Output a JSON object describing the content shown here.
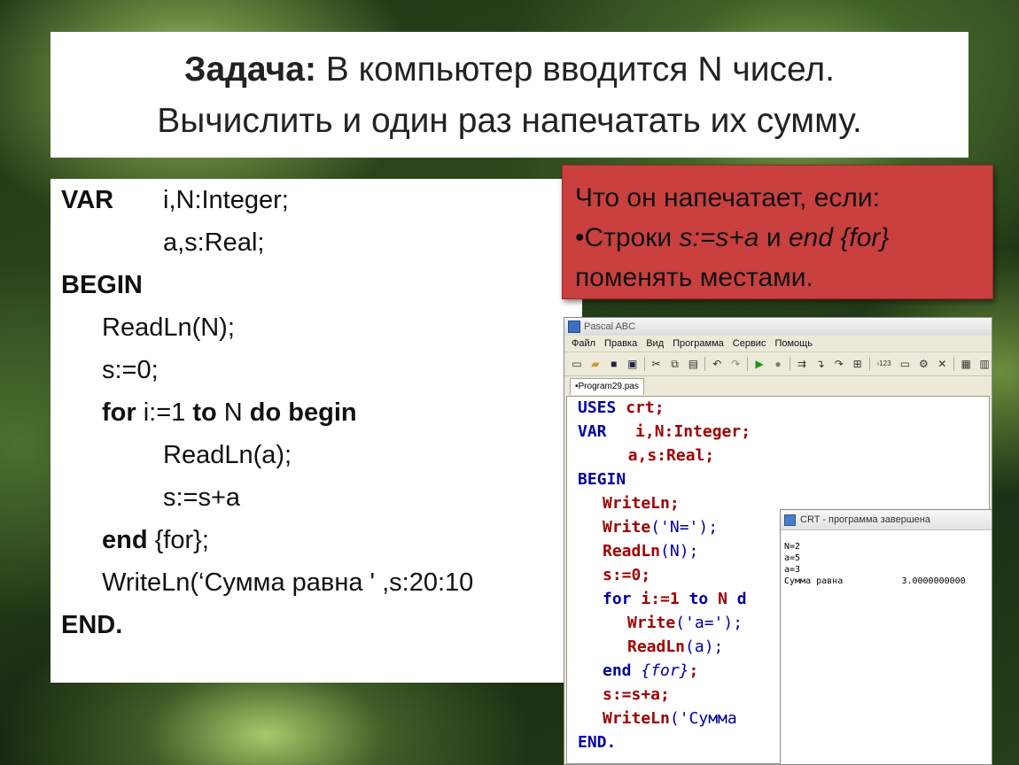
{
  "task": {
    "label": "Задача:",
    "line1": "В компьютер вводится N чисел.",
    "line2": "Вычислить и один раз напечатать их сумму."
  },
  "code": {
    "l1_kw": "VAR",
    "l1_rest": "i,N:Integer;",
    "l2": "a,s:Real;",
    "l3": "BEGIN",
    "l4": "ReadLn(N);",
    "l5": "s:=0;",
    "l6_kw1": "for",
    "l6_a": " i:=1 ",
    "l6_kw2": "to",
    "l6_b": " N ",
    "l6_kw3": "do begin",
    "l7": "ReadLn(a);",
    "l8": "s:=s+a",
    "l9_kw": "end",
    "l9_rest": " {for};",
    "l10": "WriteLn(‘Сумма равна ' ,s:20:10",
    "l11": "END."
  },
  "question": {
    "line1": "Что он напечатает, если:",
    "bullet_prefix": "•Строки ",
    "stmt1": "s:=s+a",
    "and": " и ",
    "stmt2": "end {for}",
    "line3": "поменять местами."
  },
  "pascal_window": {
    "title": "Pascal ABC",
    "menu": [
      "Файл",
      "Правка",
      "Вид",
      "Программа",
      "Сервис",
      "Помощь"
    ],
    "tab": "•Program29.pas",
    "toolbar_icons": [
      "new-file-icon",
      "open-icon",
      "save-icon",
      "save-all-icon",
      "cut-icon",
      "copy-icon",
      "paste-icon",
      "undo-icon",
      "redo-icon",
      "run-icon",
      "stop-icon",
      "step-icon",
      "step-into-icon",
      "step-over-icon",
      "watch-icon",
      "format-icon",
      "window-icon",
      "options-icon",
      "close-icon",
      "print-icon",
      "help-icon"
    ],
    "toolbar_glyphs": {
      "new": "🗋",
      "open": "📂",
      "save": "💾",
      "cut": "✂",
      "copy": "⎘",
      "paste": "📋",
      "undo": "↶",
      "redo": "↷",
      "run": "▶",
      "stop": "●",
      "x": "✕",
      "num": "›123"
    }
  },
  "editor_lines": {
    "e1a": "USES",
    "e1b": " crt;",
    "e2a": "VAR",
    "e2b": "   i,N:Integer;",
    "e3": "  a,s:Real;",
    "e4": "BEGIN",
    "e5": "WriteLn;",
    "e6a": "Write",
    "e6b": "('N=');",
    "e7a": "ReadLn",
    "e7b": "(N);",
    "e8": "s:=0;",
    "e9a": "for",
    "e9b": " i:=1 ",
    "e9c": "to",
    "e9d": " N ",
    "e9e": "d",
    "e10a": "Write",
    "e10b": "('a=');",
    "e11a": "ReadLn",
    "e11b": "(a);",
    "e12a": "end",
    "e12b": " {for}",
    "e12c": ";",
    "e13": "s:=s+a;",
    "e14a": "WriteLn",
    "e14b": "('Сумма",
    "e15": "END."
  },
  "crt_window": {
    "title": "CRT - программа завершена",
    "out1": "N=2",
    "out2": "a=5",
    "out3": "a=3",
    "out4": "Сумма равна           3.0000000000"
  }
}
